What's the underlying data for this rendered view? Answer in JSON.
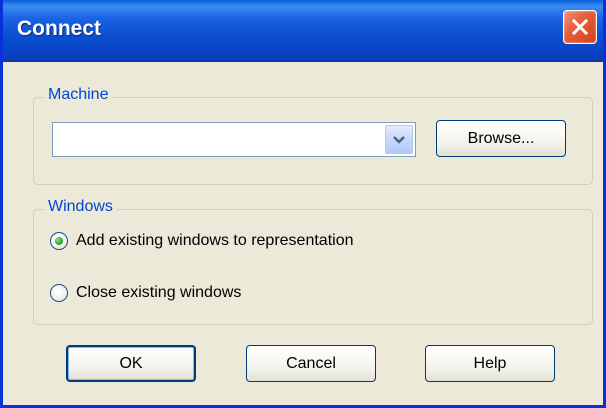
{
  "window": {
    "title": "Connect",
    "accent_color": "#0a4fd1",
    "close_icon": "close-icon"
  },
  "machine": {
    "group_label": "Machine",
    "combo_value": "",
    "browse_label": "Browse..."
  },
  "windows": {
    "group_label": "Windows",
    "options": [
      {
        "label": "Add existing windows to representation",
        "checked": true
      },
      {
        "label": "Close existing windows",
        "checked": false
      }
    ]
  },
  "buttons": {
    "ok_label": "OK",
    "cancel_label": "Cancel",
    "help_label": "Help"
  }
}
